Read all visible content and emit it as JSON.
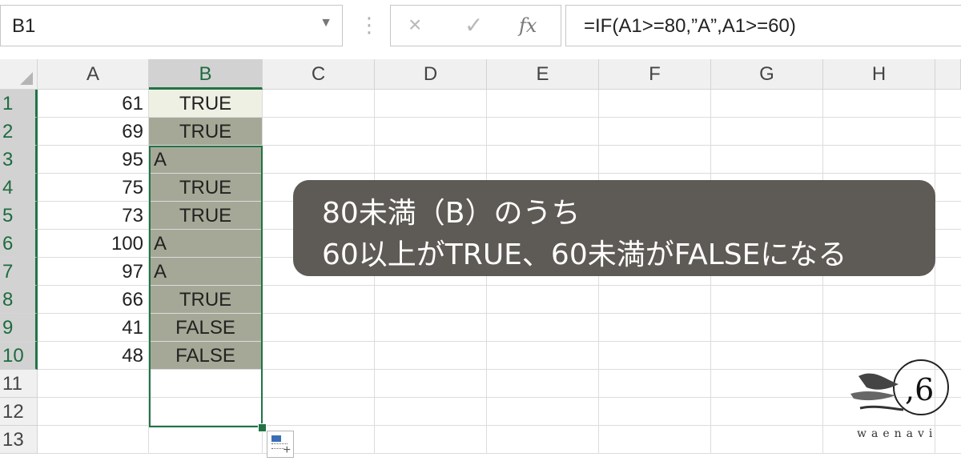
{
  "formula_bar": {
    "name_box": "B1",
    "separator": "⋮",
    "cancel_icon": "×",
    "enter_icon": "✓",
    "fx_label": "fx",
    "formula": "=IF(A1>=80,”A”,A1>=60)"
  },
  "columns": [
    "A",
    "B",
    "C",
    "D",
    "E",
    "F",
    "G",
    "H"
  ],
  "rows": [
    "1",
    "2",
    "3",
    "4",
    "5",
    "6",
    "7",
    "8",
    "9",
    "10",
    "11",
    "12",
    "13"
  ],
  "cells": {
    "A": [
      "61",
      "69",
      "95",
      "75",
      "73",
      "100",
      "97",
      "66",
      "41",
      "48"
    ],
    "B": [
      "TRUE",
      "TRUE",
      "A",
      "TRUE",
      "TRUE",
      "A",
      "A",
      "TRUE",
      "FALSE",
      "FALSE"
    ]
  },
  "selection": {
    "active_cell": "B1",
    "range": "B1:B10"
  },
  "callout": {
    "line1": "80未満（B）のうち",
    "line2": "60以上がTRUE、60未満がFALSEになる"
  },
  "watermark": {
    "text": "waenavi"
  },
  "colors": {
    "selection_border": "#217346",
    "selected_fill": "#a5a896",
    "callout_bg": "#5e5a55",
    "header_bg": "#f0f0f0"
  }
}
